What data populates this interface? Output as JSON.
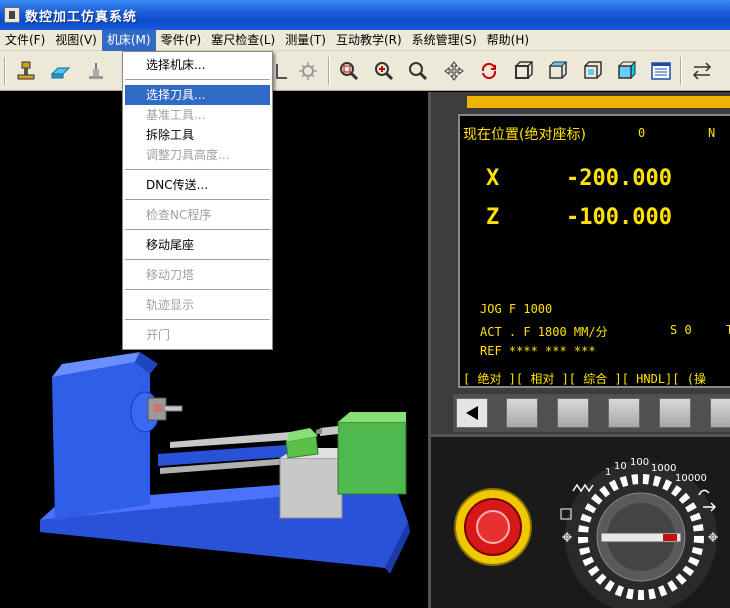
{
  "window": {
    "title": "数控加工仿真系统"
  },
  "menubar": {
    "items": [
      {
        "label": "文件(F)"
      },
      {
        "label": "视图(V)"
      },
      {
        "label": "机床(M)"
      },
      {
        "label": "零件(P)"
      },
      {
        "label": "塞尺检查(L)"
      },
      {
        "label": "测量(T)"
      },
      {
        "label": "互动教学(R)"
      },
      {
        "label": "系统管理(S)"
      },
      {
        "label": "帮助(H)"
      }
    ]
  },
  "machine_menu": {
    "items": [
      {
        "label": "选择机床...",
        "enabled": true
      },
      {
        "label": "选择刀具...",
        "enabled": true,
        "highlighted": true
      },
      {
        "label": "基准工具...",
        "enabled": false
      },
      {
        "label": "拆除工具",
        "enabled": true
      },
      {
        "label": "调整刀具高度...",
        "enabled": false
      },
      {
        "label": "DNC传送...",
        "enabled": true
      },
      {
        "label": "检查NC程序",
        "enabled": false
      },
      {
        "label": "移动尾座",
        "enabled": true
      },
      {
        "label": "移动刀塔",
        "enabled": false
      },
      {
        "label": "轨迹显示",
        "enabled": false
      },
      {
        "label": "开门",
        "enabled": false
      }
    ]
  },
  "cnc_screen": {
    "title": "现在位置(绝对座标)",
    "o_label": "0",
    "n_label": "N",
    "x_label": "X",
    "x_value": "-200.000",
    "z_label": "Z",
    "z_value": "-100.000",
    "jog_line": "JOG  F  1000",
    "act_line": "ACT . F 1800   MM/分",
    "s_line": "S  0",
    "t_label": "T",
    "ref_line": "REF **** *** ***",
    "softkeys": "[ 绝对 ][ 相对 ][ 综合 ][ HNDL][ (操"
  },
  "handwheel": {
    "scale_labels": [
      "1",
      "10",
      "100",
      "1000",
      "10000"
    ]
  },
  "colors": {
    "screen_text": "#ffe300",
    "screen_bg": "#000000",
    "menu_highlight": "#316ac5",
    "lathe_blue": "#2f5ee8",
    "tool_green": "#4fb84f"
  }
}
